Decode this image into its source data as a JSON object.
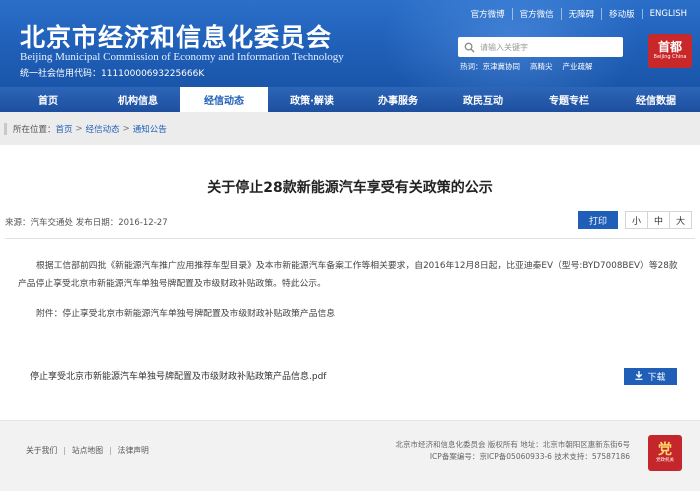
{
  "header": {
    "title": "北京市经济和信息化委员会",
    "subtitle": "Beijing Municipal Commission of Economy and Information Technology",
    "credit_code": "统一社会信用代码：11110000693225666K",
    "top_links": [
      "官方微博",
      "官方微信",
      "无障碍",
      "移动版",
      "ENGLISH"
    ],
    "search_placeholder": "请输入关键字",
    "hot_label": "热词：",
    "hot_words": [
      "京津冀协同",
      "高精尖",
      "产业疏解"
    ],
    "logo_text": "首都",
    "logo_sub": "Beijing China"
  },
  "nav": {
    "items": [
      {
        "label": "首页"
      },
      {
        "label": "机构信息"
      },
      {
        "label": "经信动态"
      },
      {
        "label": "政策·解读"
      },
      {
        "label": "办事服务"
      },
      {
        "label": "政民互动"
      },
      {
        "label": "专题专栏"
      },
      {
        "label": "经信数据"
      }
    ],
    "active_index": 2
  },
  "breadcrumb": {
    "prefix": "所在位置：",
    "items": [
      "首页",
      "经信动态",
      "通知公告"
    ],
    "separator": ">"
  },
  "article": {
    "title": "关于停止28款新能源汽车享受有关政策的公示",
    "meta": "来源：汽车交通处  发布日期：2016-12-27",
    "print_label": "打印",
    "font_sizes": [
      "小",
      "中",
      "大"
    ],
    "body": "根据工信部前四批《新能源汽车推广应用推荐车型目录》及本市新能源汽车备案工作等相关要求，自2016年12月8日起，比亚迪秦EV（型号:BYD7008BEV）等28款产品停止享受北京市新能源汽车单独号牌配置及市级财政补贴政策。特此公示。",
    "attachment": "附件：停止享受北京市新能源汽车单独号牌配置及市级财政补贴政策产品信息",
    "pdf_name": "停止享受北京市新能源汽车单独号牌配置及市级财政补贴政策产品信息.pdf",
    "download_label": "下载"
  },
  "footer": {
    "links": [
      "关于我们",
      "站点地图",
      "法律声明"
    ],
    "line1": "北京市经济和信息化委员会 版权所有  地址：北京市朝阳区惠新东街6号",
    "line2": "ICP备案编号：京ICP备05060933-6  技术支持：57587186",
    "badge_text": "党",
    "badge_sub": "党政机关"
  },
  "colors": {
    "header_blue": "#1f5fb8",
    "nav_blue": "#2d66b8",
    "logo_red": "#c8282a"
  }
}
